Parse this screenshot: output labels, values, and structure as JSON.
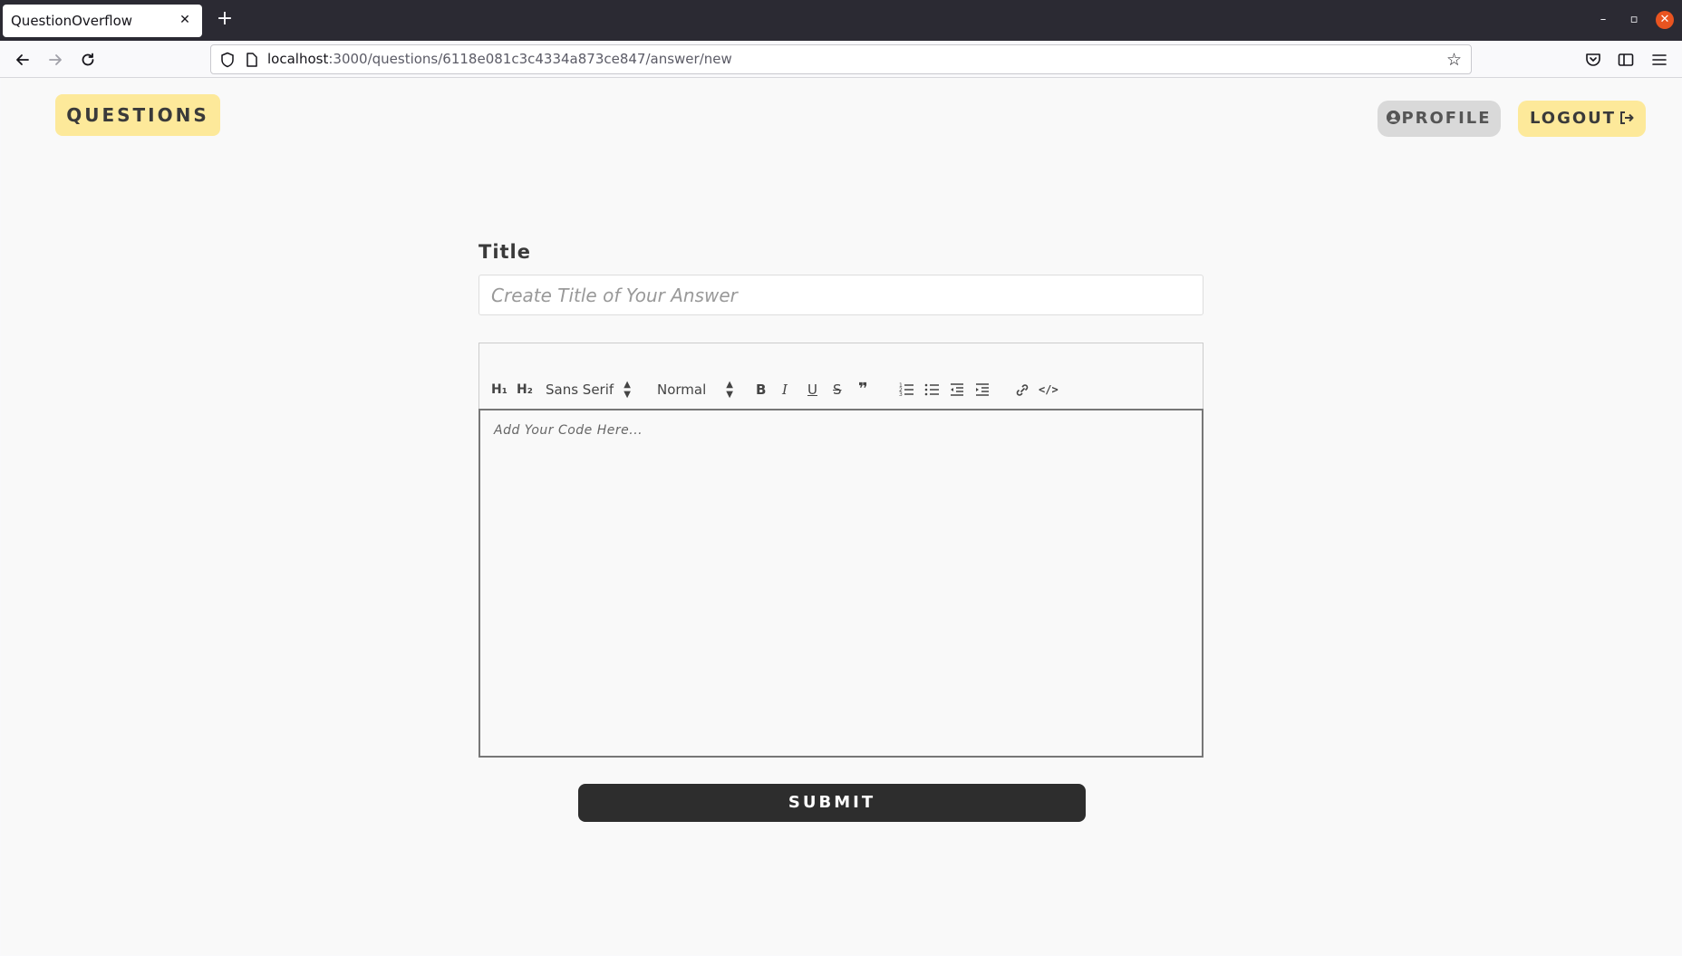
{
  "browser": {
    "tab_title": "QuestionOverflow",
    "tab_close": "✕",
    "new_tab": "+",
    "url_host": "localhost",
    "url_path": ":3000/questions/6118e081c3c4334a873ce847/answer/new",
    "window_min": "–",
    "window_max": "▫",
    "window_close": "✕"
  },
  "header": {
    "questions_label": "QUESTIONS",
    "profile_label": "PROFILE",
    "logout_label": "LOGOUT"
  },
  "form": {
    "title_label": "Title",
    "title_placeholder": "Create Title of Your Answer",
    "title_value": "",
    "toolbar": {
      "h1": "H₁",
      "h2": "H₂",
      "font": "Sans Serif",
      "size": "Normal",
      "bold": "B",
      "italic": "I",
      "underline": "U",
      "strike": "S",
      "quote": "❞",
      "code": "</>"
    },
    "editor_placeholder": "Add Your Code Here...",
    "submit_label": "SUBMIT"
  },
  "colors": {
    "accent_yellow": "#fde99a",
    "profile_gray": "#d9d9d9",
    "submit_dark": "#2d2d2d",
    "window_close": "#e95420"
  }
}
